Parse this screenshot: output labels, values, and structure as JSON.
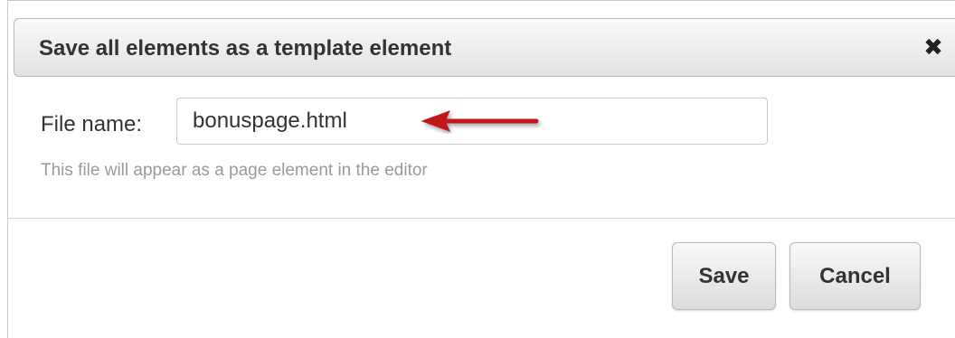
{
  "dialog": {
    "title": "Save all elements as a template element",
    "close_icon": "close-icon",
    "close_glyph": "✖"
  },
  "form": {
    "file_name_label": "File name:",
    "file_name_value": "bonuspage.html",
    "help_text": "This file will appear as a page element in the editor",
    "annotation": "red-arrow-icon",
    "annotation_color": "#c0141c"
  },
  "buttons": {
    "save_label": "Save",
    "cancel_label": "Cancel"
  }
}
